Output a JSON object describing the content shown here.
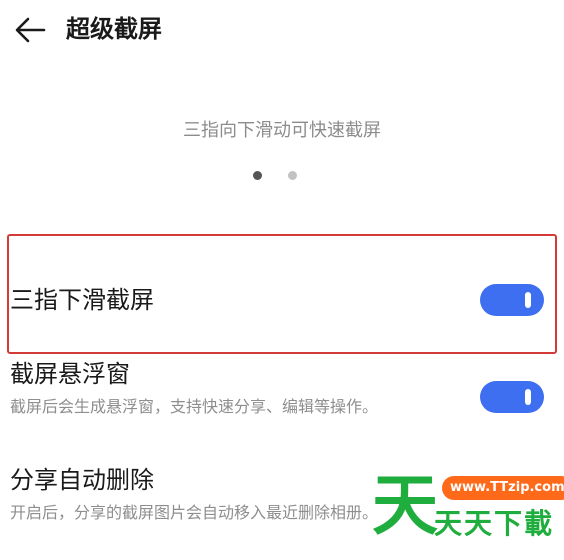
{
  "header": {
    "title": "超级截屏",
    "back_icon": "arrow-left-icon"
  },
  "hint": {
    "text": "三指向下滑动可快速截屏",
    "pages": 2,
    "active_page": 1
  },
  "settings": [
    {
      "label": "三指下滑截屏",
      "description": "",
      "enabled": true,
      "highlighted": true
    },
    {
      "label": "截屏悬浮窗",
      "description": "截屏后会生成悬浮窗，支持快速分享、编辑等操作。",
      "enabled": true,
      "highlighted": false
    },
    {
      "label": "分享自动删除",
      "description": "开启后，分享的截屏图片会自动移入最近删除相册。",
      "enabled": false,
      "highlighted": false
    }
  ],
  "watermark": {
    "logo_char": "天",
    "url": "www.TTzip.com",
    "name": "天天下載"
  },
  "colors": {
    "accent": "#3e6ff1",
    "highlight_border": "#d23b37",
    "secondary_text": "#8e8e8e",
    "watermark_green": "#1fae3e",
    "watermark_orange": "#ff6a1a"
  }
}
